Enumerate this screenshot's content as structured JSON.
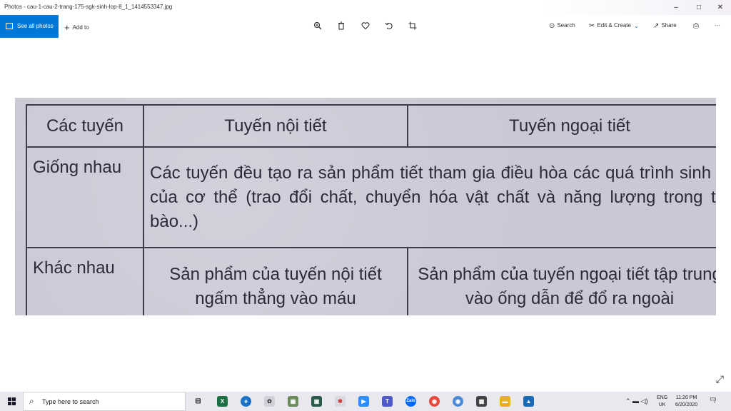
{
  "window": {
    "title": "Photos - cau-1-cau-2-trang-175-sgk-sinh-lop-8_1_1414553347.jpg",
    "minimize": "–",
    "maximize": "□",
    "close": "✕"
  },
  "toolbar": {
    "see_all_photos": "See all photos",
    "add_to": "Add to",
    "search": "Search",
    "edit_create": "Edit & Create",
    "share": "Share",
    "more": "···"
  },
  "photo": {
    "table": {
      "headers": [
        "Các tuyến",
        "Tuyến nội tiết",
        "Tuyến ngoại tiết"
      ],
      "row1_label": "Giống nhau",
      "row1_text": "Các tuyến đều tạo ra sản phẩm tiết tham gia điều hòa các quá trình sinh lí của cơ thể (trao đổi chất, chuyển hóa vật chất và năng lượng trong tế bào...)",
      "row2_label": "Khác nhau",
      "row2_endocrine": "Sản phẩm của tuyến nội tiết ngấm thẳng vào máu",
      "row2_exocrine": "Sản phẩm của tuyến ngoại tiết tập trung vào ống dẫn để đổ ra ngoài"
    }
  },
  "taskbar": {
    "search_placeholder": "Type here to search",
    "language": "ENG",
    "region": "UK",
    "time": "11:20 PM",
    "date": "6/20/2020",
    "notification_count": "7"
  },
  "colors": {
    "accent": "#0078d7",
    "taskbar": "#e8e8ee"
  }
}
